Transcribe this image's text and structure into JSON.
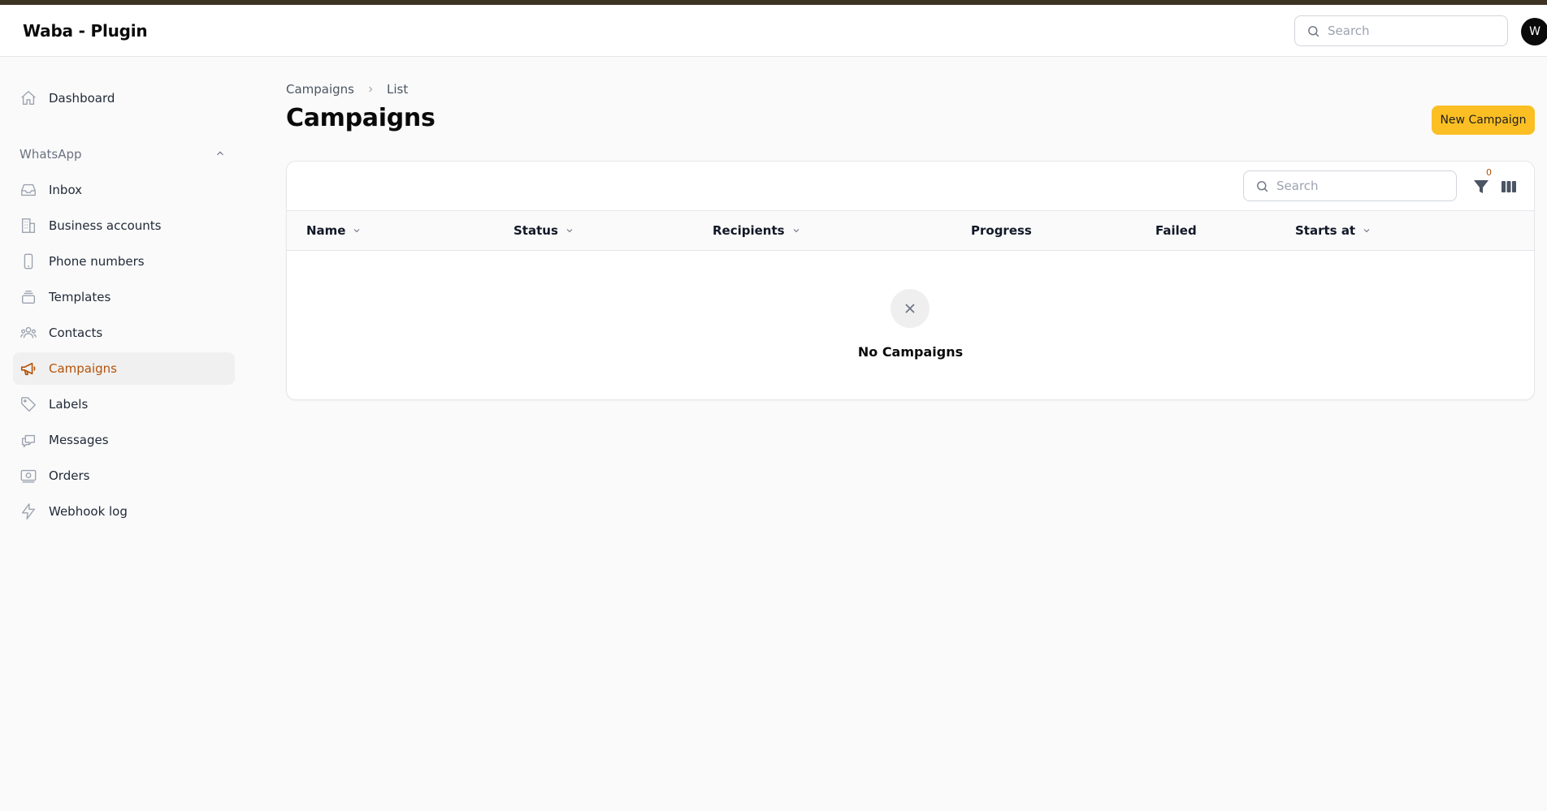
{
  "app": {
    "title": "Waba - Plugin"
  },
  "header": {
    "search_placeholder": "Search",
    "avatar_initial": "W"
  },
  "sidebar": {
    "dashboard": "Dashboard",
    "group_label": "WhatsApp",
    "items": [
      {
        "label": "Inbox",
        "icon": "inbox-icon"
      },
      {
        "label": "Business accounts",
        "icon": "building-icon"
      },
      {
        "label": "Phone numbers",
        "icon": "phone-icon"
      },
      {
        "label": "Templates",
        "icon": "stack-icon"
      },
      {
        "label": "Contacts",
        "icon": "users-icon"
      },
      {
        "label": "Campaigns",
        "icon": "megaphone-icon",
        "active": true
      },
      {
        "label": "Labels",
        "icon": "tag-icon"
      },
      {
        "label": "Messages",
        "icon": "chat-bubbles-icon"
      },
      {
        "label": "Orders",
        "icon": "cash-icon"
      },
      {
        "label": "Webhook log",
        "icon": "bolt-icon"
      }
    ]
  },
  "breadcrumb": {
    "parent": "Campaigns",
    "current": "List"
  },
  "page": {
    "title": "Campaigns",
    "new_button": "New Campaign"
  },
  "table": {
    "search_placeholder": "Search",
    "filter_count": "0",
    "columns": [
      "Name",
      "Status",
      "Recipients",
      "Progress",
      "Failed",
      "Starts at"
    ],
    "empty_message": "No Campaigns"
  },
  "colors": {
    "accent": "#fbbf24",
    "active_text": "#b45309",
    "top_strip": "#3d3323"
  }
}
